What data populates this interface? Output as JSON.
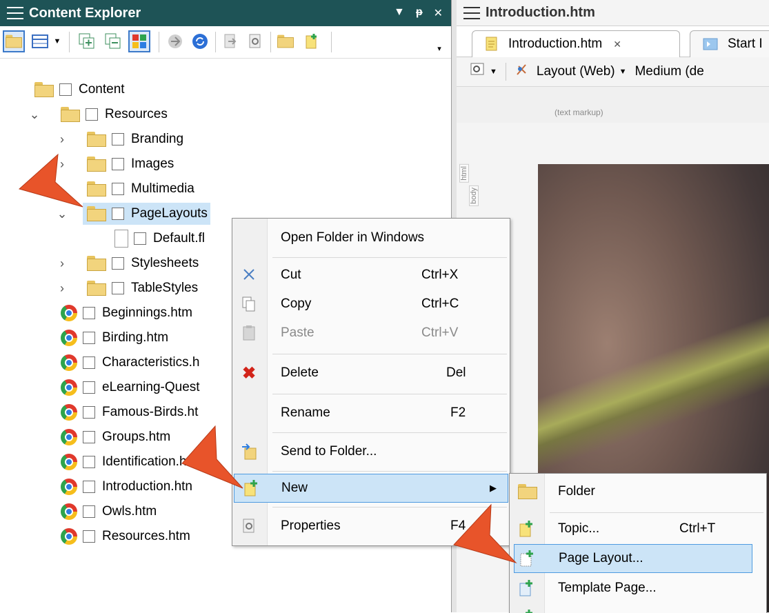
{
  "left_panel": {
    "title": "Content Explorer",
    "controls": {
      "dropdown": "▼",
      "pin": "\u0004",
      "close": "✕"
    },
    "tree": [
      {
        "label": "Content",
        "type": "folder"
      },
      {
        "label": "Resources",
        "type": "folder"
      },
      {
        "label": "Branding",
        "type": "folder"
      },
      {
        "label": "Images",
        "type": "folder"
      },
      {
        "label": "Multimedia",
        "type": "folder"
      },
      {
        "label": "PageLayouts",
        "type": "folder"
      },
      {
        "label": "Default.fl",
        "type": "file"
      },
      {
        "label": "Stylesheets",
        "type": "folder"
      },
      {
        "label": "TableStyles",
        "type": "folder"
      },
      {
        "label": "Beginnings.htm",
        "type": "htm"
      },
      {
        "label": "Birding.htm",
        "type": "htm"
      },
      {
        "label": "Characteristics.h",
        "type": "htm"
      },
      {
        "label": "eLearning-Quest",
        "type": "htm"
      },
      {
        "label": "Famous-Birds.ht",
        "type": "htm"
      },
      {
        "label": "Groups.htm",
        "type": "htm"
      },
      {
        "label": "Identification.ht",
        "type": "htm"
      },
      {
        "label": "Introduction.htn",
        "type": "htm"
      },
      {
        "label": "Owls.htm",
        "type": "htm"
      },
      {
        "label": "Resources.htm",
        "type": "htm"
      }
    ]
  },
  "right_panel": {
    "title": "Introduction.htm",
    "tabs": [
      {
        "label": "Introduction.htm",
        "close": "✕"
      },
      {
        "label": "Start I"
      }
    ],
    "toolbar": {
      "layout": "Layout (Web)",
      "medium": "Medium (de"
    },
    "markup_label": "(text markup)",
    "ruler": {
      "html": "html",
      "body": "body"
    }
  },
  "context_menu": {
    "items": [
      {
        "label": "Open Folder in Windows",
        "shortcut": ""
      },
      {
        "label": "Cut",
        "shortcut": "Ctrl+X"
      },
      {
        "label": "Copy",
        "shortcut": "Ctrl+C"
      },
      {
        "label": "Paste",
        "shortcut": "Ctrl+V"
      },
      {
        "label": "Delete",
        "shortcut": "Del"
      },
      {
        "label": "Rename",
        "shortcut": "F2"
      },
      {
        "label": "Send to Folder...",
        "shortcut": ""
      },
      {
        "label": "New",
        "shortcut": ""
      },
      {
        "label": "Properties",
        "shortcut": "F4"
      }
    ]
  },
  "submenu": {
    "items": [
      {
        "label": "Folder",
        "shortcut": ""
      },
      {
        "label": "Topic...",
        "shortcut": "Ctrl+T"
      },
      {
        "label": "Page Layout...",
        "shortcut": ""
      },
      {
        "label": "Template Page...",
        "shortcut": ""
      }
    ]
  },
  "colors": {
    "title_bar": "#1e5356",
    "highlight": "#cce4f7",
    "callout_arrow": "#e8542a"
  }
}
